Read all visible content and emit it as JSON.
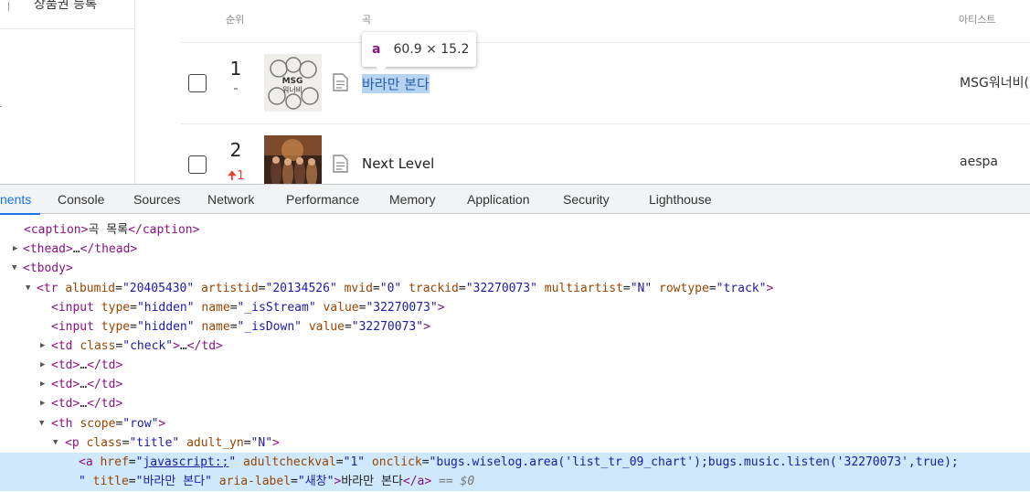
{
  "sidebar": {
    "nav_item": "상품권 등록"
  },
  "chart": {
    "columns": {
      "rank": "순위",
      "title": "곡",
      "artist": "아티스트"
    },
    "rows": [
      {
        "rank": "1",
        "change": "-",
        "change_type": "same",
        "title": "바라만 본다",
        "artist": "MSG워너비(",
        "cover_text": "MSG 워너비",
        "selected": true
      },
      {
        "rank": "2",
        "change": "1",
        "change_type": "up",
        "title": "Next Level",
        "artist": "aespa",
        "cover_text": "",
        "selected": false
      }
    ]
  },
  "tooltip": {
    "tag": "a",
    "dimensions": "60.9 × 15.2"
  },
  "devtools": {
    "tabs": [
      {
        "label": "nents",
        "active": true
      },
      {
        "label": "Console"
      },
      {
        "label": "Sources"
      },
      {
        "label": "Network"
      },
      {
        "label": "Performance"
      },
      {
        "label": "Memory"
      },
      {
        "label": "Application"
      },
      {
        "label": "Security"
      },
      {
        "label": "Lighthouse"
      }
    ],
    "dom": {
      "caption_text": "곡 목록",
      "thead_tag": "thead",
      "tbody_tag": "tbody",
      "tr": {
        "albumid": "20405430",
        "artistid": "20134526",
        "mvid": "0",
        "trackid": "32270073",
        "multiartist": "N",
        "rowtype": "track"
      },
      "input1": {
        "type": "hidden",
        "name": "_isStream",
        "value": "32270073"
      },
      "input2": {
        "type": "hidden",
        "name": "_isDown",
        "value": "32270073"
      },
      "td_check_class": "check",
      "th_scope": "row",
      "p": {
        "class": "title",
        "adult_yn": "N"
      },
      "a": {
        "href": "javascript:;",
        "adultcheckval": "1",
        "onclick": "bugs.wiselog.area('list_tr_09_chart');bugs.music.listen('32270073',true);",
        "title": "바라만 본다",
        "aria_label": "새창",
        "text": "바라만 본다",
        "selected_marker": "== $0"
      }
    }
  },
  "colors": {
    "devtools_active": "#1a73e8",
    "selection": "#cfe8fc",
    "rank_up": "#e8412c"
  }
}
